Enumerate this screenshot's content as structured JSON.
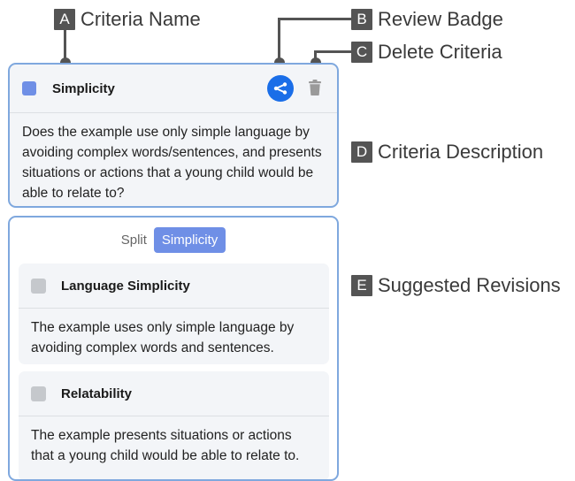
{
  "annotations": {
    "a": {
      "letter": "A",
      "text": "Criteria Name"
    },
    "b": {
      "letter": "B",
      "text": "Review Badge"
    },
    "c": {
      "letter": "C",
      "text": "Delete Criteria"
    },
    "d": {
      "letter": "D",
      "text": "Criteria Description"
    },
    "e": {
      "letter": "E",
      "text": "Suggested Revisions"
    }
  },
  "criteria": {
    "name": "Simplicity",
    "swatch_color": "#6f8fe6",
    "badge_icon": "share-branch-icon",
    "delete_icon": "trash-icon",
    "description": "Does the example use only simple language by avoiding complex words/sentences, and presents situations or actions that a young child would be able to relate to?"
  },
  "revisions": {
    "tabs": [
      "Split",
      "Simplicity"
    ],
    "items": [
      {
        "name": "Language Simplicity",
        "description": "The example uses only simple language by avoiding complex words and sentences."
      },
      {
        "name": "Relatability",
        "description": "The example presents situations or actions that a young child would be able to relate to."
      }
    ]
  }
}
